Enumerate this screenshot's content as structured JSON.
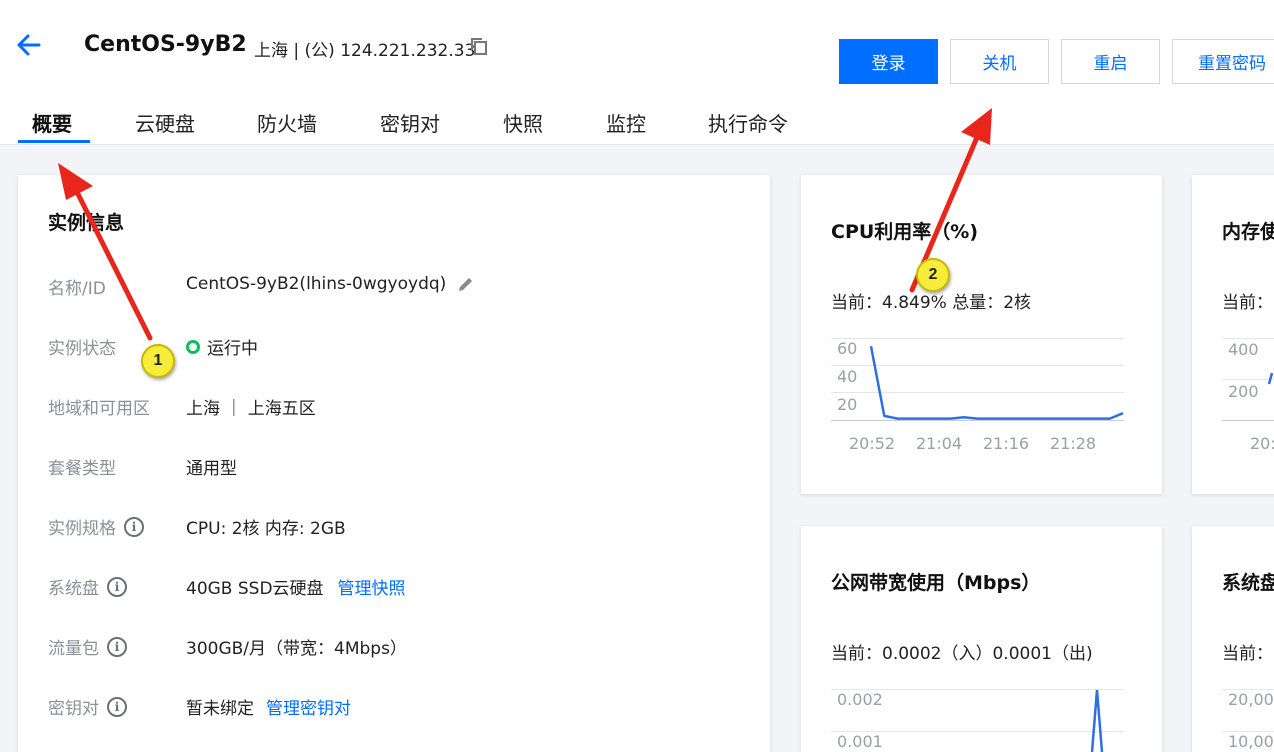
{
  "header": {
    "title": "CentOS-9yB2",
    "location": "上海 | (公) 124.221.232.33",
    "buttons": {
      "login": "登录",
      "shutdown": "关机",
      "restart": "重启",
      "reset_password": "重置密码"
    }
  },
  "tabs": [
    "概要",
    "云硬盘",
    "防火墙",
    "密钥对",
    "快照",
    "监控",
    "执行命令"
  ],
  "instance": {
    "title": "实例信息",
    "rows": [
      {
        "label": "名称/ID",
        "value": "CentOS-9yB2(lhins-0wgyoydq)"
      },
      {
        "label": "实例状态",
        "value": "运行中"
      },
      {
        "label": "地域和可用区",
        "value": "上海 ｜ 上海五区"
      },
      {
        "label": "套餐类型",
        "value": "通用型"
      },
      {
        "label": "实例规格",
        "value": "CPU: 2核 内存: 2GB"
      },
      {
        "label": "系统盘",
        "value": "40GB SSD云硬盘",
        "link": "管理快照"
      },
      {
        "label": "流量包",
        "value": "300GB/月（带宽：4Mbps）"
      },
      {
        "label": "密钥对",
        "value": "暂未绑定",
        "link": "管理密钥对"
      }
    ]
  },
  "cpu_card": {
    "title": "CPU利用率（%)",
    "current": "当前：4.849% 总量：2核"
  },
  "mem_card": {
    "title": "内存使",
    "current": "当前："
  },
  "net_card": {
    "title": "公网带宽使用（Mbps）",
    "current": "当前：0.0002（入）0.0001（出)"
  },
  "disk_card": {
    "title": "系统盘",
    "current": "当前："
  },
  "annotations": [
    "1",
    "2"
  ],
  "chart_data": [
    {
      "type": "line",
      "title": "CPU利用率（%)",
      "yticks": [
        "60",
        "40",
        "20"
      ],
      "xticks": [
        "20:52",
        "21:04",
        "21:16",
        "21:28"
      ],
      "ylim": [
        0,
        60
      ],
      "series": [
        {
          "values": [
            54,
            3,
            1,
            1,
            1,
            1,
            1,
            2,
            1,
            1,
            1,
            1,
            1,
            1,
            1,
            1,
            1,
            1,
            1,
            5
          ]
        }
      ]
    },
    {
      "type": "line",
      "yticks": [
        "400",
        "200"
      ],
      "xticks": [
        "20:"
      ]
    },
    {
      "type": "line",
      "title": "公网带宽使用（Mbps）",
      "yticks": [
        "0.002",
        "0.001"
      ]
    },
    {
      "type": "line",
      "yticks": [
        "20,000",
        "10,000"
      ]
    }
  ],
  "colors": {
    "accent": "#006eff",
    "running": "#0abf5b",
    "line": "#2f6fe0",
    "arrow": "#e8261c"
  }
}
